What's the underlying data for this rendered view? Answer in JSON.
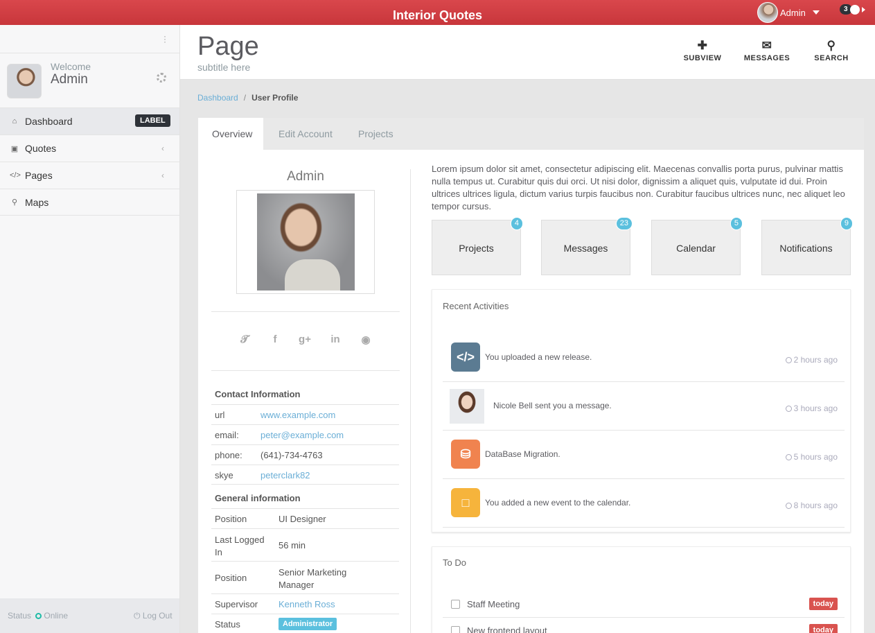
{
  "app": {
    "title": "Interior Quotes",
    "user_name": "Admin",
    "notifications_count": "3"
  },
  "sidebar": {
    "welcome": "Welcome",
    "name": "Admin",
    "items": [
      {
        "label": "Dashboard",
        "icon": "home-icon",
        "badge": "LABEL"
      },
      {
        "label": "Quotes",
        "icon": "desktop-icon"
      },
      {
        "label": "Pages",
        "icon": "code-icon"
      },
      {
        "label": "Maps",
        "icon": "map-marker-icon"
      }
    ],
    "status_label": "Status",
    "status_value": "Online",
    "logout": "Log Out"
  },
  "header": {
    "title": "Page",
    "subtitle": "subtitle here",
    "tools": [
      {
        "label": "SUBVIEW",
        "icon": "plus-icon"
      },
      {
        "label": "MESSAGES",
        "icon": "envelope-icon"
      },
      {
        "label": "SEARCH",
        "icon": "search-icon"
      }
    ]
  },
  "breadcrumb": {
    "root": "Dashboard",
    "separator": "/",
    "current": "User Profile"
  },
  "tabs": [
    "Overview",
    "Edit Account",
    "Projects"
  ],
  "profile": {
    "name": "Admin",
    "contact_title": "Contact Information",
    "contact": [
      {
        "key": "url",
        "value": "www.example.com"
      },
      {
        "key": "email:",
        "value": "peter@example.com"
      },
      {
        "key": "phone:",
        "value": "(641)-734-4763"
      },
      {
        "key": "skye",
        "value": "peterclark82"
      }
    ],
    "general_title": "General information",
    "general": [
      {
        "key": "Position",
        "value": "UI Designer"
      },
      {
        "key": "Last Logged In",
        "value": "56 min"
      },
      {
        "key": "Position",
        "value": "Senior Marketing Manager"
      },
      {
        "key": "Supervisor",
        "value": "Kenneth Ross"
      },
      {
        "key": "Status",
        "value": "Administrator"
      }
    ]
  },
  "overview": {
    "text": "Lorem ipsum dolor sit amet, consectetur adipiscing elit. Maecenas convallis porta purus, pulvinar mattis nulla tempus ut. Curabitur quis dui orci. Ut nisi dolor, dignissim a aliquet quis, vulputate id dui. Proin ultrices ultrices ligula, dictum varius turpis faucibus non. Curabitur faucibus ultrices nunc, nec aliquet leo tempor cursus.",
    "stats": [
      {
        "label": "Projects",
        "count": "4"
      },
      {
        "label": "Messages",
        "count": "23"
      },
      {
        "label": "Calendar",
        "count": "5"
      },
      {
        "label": "Notifications",
        "count": "9"
      }
    ]
  },
  "activities": {
    "title": "Recent Activities",
    "items": [
      {
        "text": "You uploaded a new release.",
        "time": "2 hours ago",
        "icon": "code-icon",
        "color": "#5b7b92"
      },
      {
        "text": "Nicole Bell sent you a message.",
        "time": "3 hours ago",
        "icon": "avatar"
      },
      {
        "text": "DataBase Migration.",
        "time": "5 hours ago",
        "icon": "database-icon",
        "color": "#f0834f"
      },
      {
        "text": "You added a new event to the calendar.",
        "time": "8 hours ago",
        "icon": "calendar-icon",
        "color": "#f6b43c"
      }
    ]
  },
  "todo": {
    "title": "To Do",
    "items": [
      {
        "text": "Staff Meeting",
        "tag": "today"
      },
      {
        "text": "New frontend layout",
        "tag": "today"
      }
    ]
  },
  "colors": {
    "topbar": "#d9474c",
    "accent_link": "#6aaed6",
    "badge_info": "#5bc0de",
    "badge_danger": "#d9534f",
    "online": "#1fbba6"
  }
}
